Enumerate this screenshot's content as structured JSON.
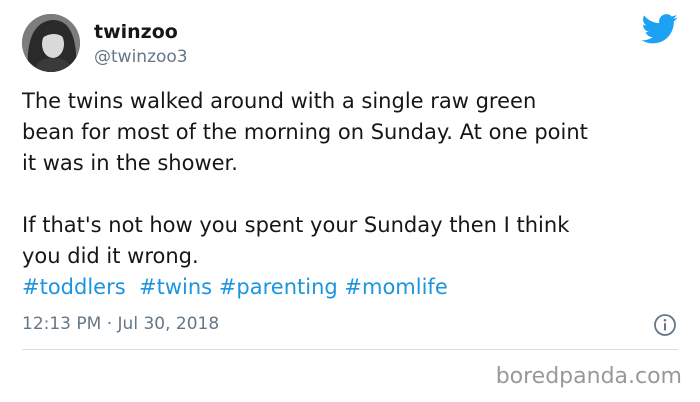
{
  "author": {
    "display_name": "twinzoo",
    "handle": "@twinzoo3"
  },
  "tweet": {
    "paragraph_1": "The twins walked around with a single raw green\nbean for most of the morning on Sunday. At one point\nit was in the shower.",
    "paragraph_2": "If that's not how you spent your Sunday then I think\nyou did it wrong.",
    "hashtags": [
      "#toddlers",
      "#twins",
      "#parenting",
      "#momlife"
    ]
  },
  "timestamp": {
    "time": "12:13 PM",
    "separator": " · ",
    "date": "Jul 30, 2018"
  },
  "watermark": "boredpanda.com",
  "icons": {
    "brand": "twitter-bird-icon",
    "info": "info-icon"
  },
  "colors": {
    "link": "#1b95e0",
    "bird": "#1da1f2",
    "secondary_text": "#657786"
  }
}
